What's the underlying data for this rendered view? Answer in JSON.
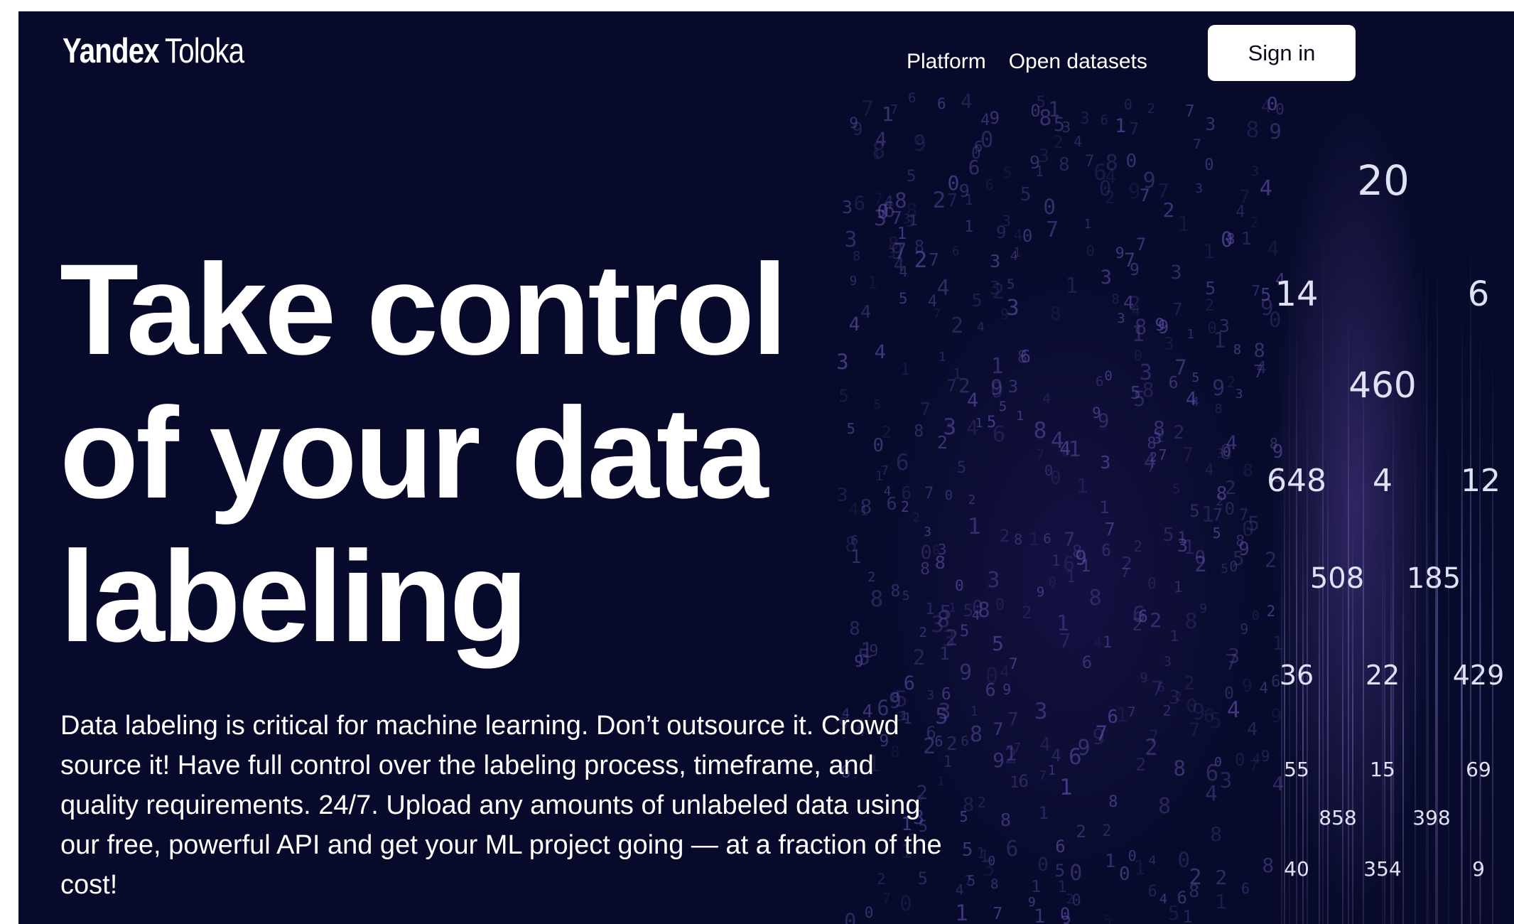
{
  "header": {
    "logo_brand": "Yandex",
    "logo_product": "Toloka",
    "nav": [
      "Platform",
      "Open datasets"
    ],
    "signin_label": "Sign in"
  },
  "hero": {
    "headline_lines": [
      "Take control",
      "of your data",
      "labeling"
    ],
    "description": "Data labeling is critical for machine learning. Don’t outsource it. Crowd source it! Have full control over the labeling process, timeframe, and quality requirements. 24/7. Upload any amounts of unlabeled data using our free, powerful API and get your ML project going — at a fraction of the cost!"
  },
  "stats_numbers": [
    "20",
    "14",
    "6",
    "460",
    "648",
    "4",
    "12",
    "508",
    "185",
    "36",
    "22",
    "429",
    "55",
    "15",
    "69",
    "858",
    "398",
    "40",
    "354",
    "9"
  ],
  "colors": {
    "background": "#070a2a",
    "text": "#ffffff",
    "button_bg": "#ffffff",
    "button_text": "#0a0a1a"
  }
}
